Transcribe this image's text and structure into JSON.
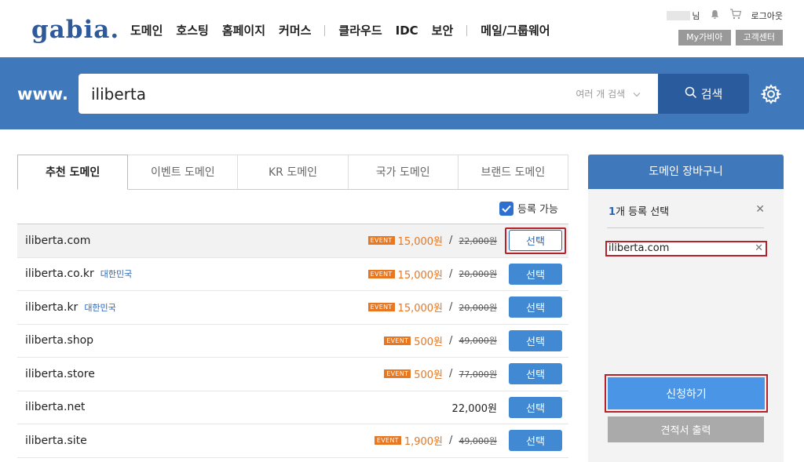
{
  "header": {
    "logo": "gabia",
    "nav": [
      "도메인",
      "호스팅",
      "홈페이지",
      "커머스",
      "클라우드",
      "IDC",
      "보안",
      "메일/그룹웨어"
    ],
    "user_suffix": "님",
    "logout": "로그아웃",
    "my_gabia": "My가비아",
    "support": "고객센터"
  },
  "search": {
    "prefix": "www.",
    "query": "iliberta",
    "multi_search": "여러 개 검색",
    "button": "검색"
  },
  "tabs": [
    "추천 도메인",
    "이벤트 도메인",
    "KR 도메인",
    "국가 도메인",
    "브랜드 도메인"
  ],
  "available_only": "등록 가능",
  "event_badge": "EVENT",
  "select_label": "선택",
  "results": [
    {
      "domain": "iliberta.com",
      "country": "",
      "event": true,
      "sale": "15,000원",
      "original": "22,000원"
    },
    {
      "domain": "iliberta.co.kr",
      "country": "대한민국",
      "event": true,
      "sale": "15,000원",
      "original": "20,000원"
    },
    {
      "domain": "iliberta.kr",
      "country": "대한민국",
      "event": true,
      "sale": "15,000원",
      "original": "20,000원"
    },
    {
      "domain": "iliberta.shop",
      "country": "",
      "event": true,
      "sale": "500원",
      "original": "49,000원"
    },
    {
      "domain": "iliberta.store",
      "country": "",
      "event": true,
      "sale": "500원",
      "original": "77,000원"
    },
    {
      "domain": "iliberta.net",
      "country": "",
      "event": false,
      "sale": "22,000원",
      "original": ""
    },
    {
      "domain": "iliberta.site",
      "country": "",
      "event": true,
      "sale": "1,900원",
      "original": "49,000원"
    }
  ],
  "cart": {
    "title": "도메인 장바구니",
    "count": "1",
    "count_suffix": "개 등록 선택",
    "item": "iliberta.com",
    "apply": "신청하기",
    "quote": "견적서 출력"
  },
  "colors": {
    "brand": "#3f79bc",
    "event": "#e87722",
    "select": "#4189d3",
    "highlight": "#b8202a"
  }
}
